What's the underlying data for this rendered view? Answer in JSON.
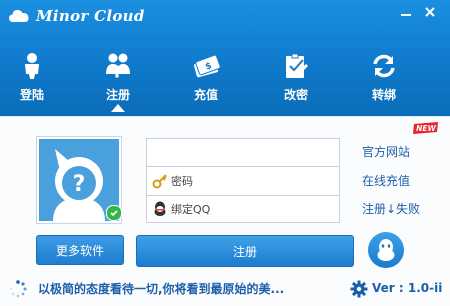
{
  "app": {
    "title": "Minor Cloud"
  },
  "nav": {
    "items": [
      {
        "label": "登陆",
        "icon": "login-person-icon"
      },
      {
        "label": "注册",
        "icon": "register-users-icon"
      },
      {
        "label": "充值",
        "icon": "recharge-money-icon"
      },
      {
        "label": "改密",
        "icon": "change-password-icon"
      },
      {
        "label": "转绑",
        "icon": "rebind-refresh-icon"
      }
    ],
    "active": "注册"
  },
  "form": {
    "username_value": "",
    "password_label": "密码",
    "bind_qq_label": "绑定QQ"
  },
  "links": {
    "official_site": "官方网站",
    "online_charge": "在线充值",
    "register_fail": "注册↓失败",
    "new_badge": "NEW"
  },
  "buttons": {
    "more_software": "更多软件",
    "register": "注册"
  },
  "footer": {
    "slogan": "以极简的态度看待一切,你将看到最原始的美...",
    "version": "Ver : 1.0-ii"
  },
  "colors": {
    "header_blue": "#1b8fe0",
    "link_blue": "#1c5fa8",
    "button_blue": "#2a8bd8"
  }
}
